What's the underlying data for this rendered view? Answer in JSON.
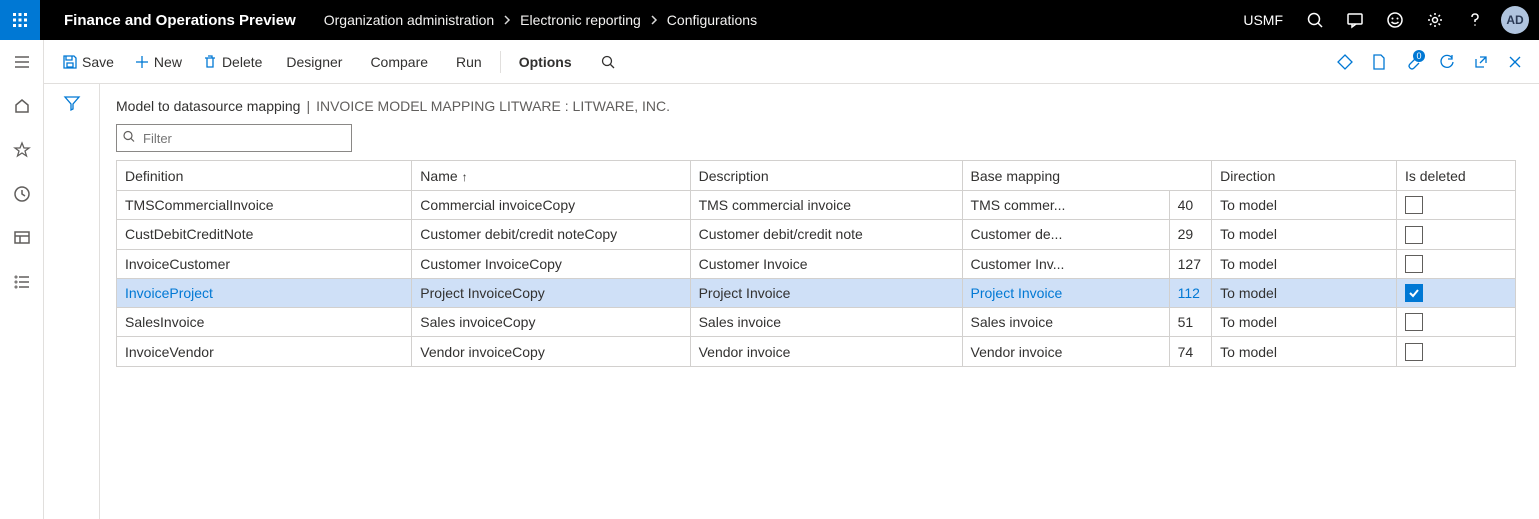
{
  "app_title": "Finance and Operations Preview",
  "breadcrumbs": [
    "Organization administration",
    "Electronic reporting",
    "Configurations"
  ],
  "company": "USMF",
  "avatar": "AD",
  "actions": {
    "save": "Save",
    "new": "New",
    "delete": "Delete",
    "designer": "Designer",
    "compare": "Compare",
    "run": "Run",
    "options": "Options"
  },
  "attach_badge": "0",
  "page_header": {
    "title": "Model to datasource mapping",
    "sep": "|",
    "subtitle": "INVOICE MODEL MAPPING LITWARE : LITWARE, INC."
  },
  "filter_placeholder": "Filter",
  "columns": {
    "definition": "Definition",
    "name": "Name",
    "description": "Description",
    "base_mapping": "Base mapping",
    "direction": "Direction",
    "is_deleted": "Is deleted"
  },
  "rows": [
    {
      "definition": "TMSCommercialInvoice",
      "name": "Commercial invoiceCopy",
      "description": "TMS commercial invoice",
      "base": "TMS commer...",
      "num": "40",
      "direction": "To model",
      "deleted": false,
      "selected": false
    },
    {
      "definition": "CustDebitCreditNote",
      "name": "Customer debit/credit noteCopy",
      "description": "Customer debit/credit note",
      "base": "Customer de...",
      "num": "29",
      "direction": "To model",
      "deleted": false,
      "selected": false
    },
    {
      "definition": "InvoiceCustomer",
      "name": "Customer InvoiceCopy",
      "description": "Customer Invoice",
      "base": "Customer Inv...",
      "num": "127",
      "direction": "To model",
      "deleted": false,
      "selected": false
    },
    {
      "definition": "InvoiceProject",
      "name": "Project InvoiceCopy",
      "description": "Project Invoice",
      "base": "Project Invoice",
      "num": "112",
      "direction": "To model",
      "deleted": true,
      "selected": true
    },
    {
      "definition": "SalesInvoice",
      "name": "Sales invoiceCopy",
      "description": "Sales invoice",
      "base": "Sales invoice",
      "num": "51",
      "direction": "To model",
      "deleted": false,
      "selected": false
    },
    {
      "definition": "InvoiceVendor",
      "name": "Vendor invoiceCopy",
      "description": "Vendor invoice",
      "base": "Vendor invoice",
      "num": "74",
      "direction": "To model",
      "deleted": false,
      "selected": false
    }
  ]
}
